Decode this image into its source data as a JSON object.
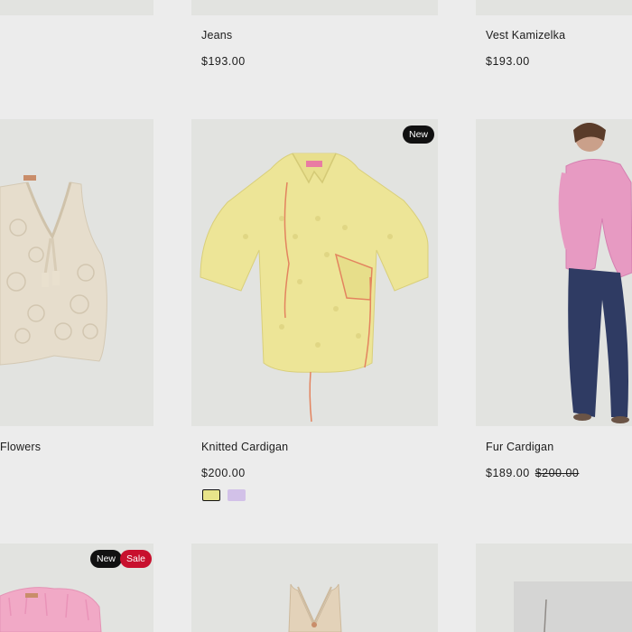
{
  "products": [
    {
      "name": "Jeans",
      "price": "$193.00"
    },
    {
      "name": "Vest Kamizelka",
      "price": "$193.00"
    },
    {
      "name": "Flowers"
    },
    {
      "name": "Knitted Cardigan",
      "price": "$200.00",
      "badge": "New",
      "swatches": [
        {
          "color": "#e8e48a",
          "selected": true
        },
        {
          "color": "#d2c1e8",
          "selected": false
        }
      ]
    },
    {
      "name": "Fur Cardigan",
      "price": "$189.00",
      "compare_price": "$200.00"
    },
    {
      "badges": [
        "New",
        "Sale"
      ]
    }
  ],
  "colors": {
    "background": "#ececec",
    "image_bg": "#e2e3e0",
    "badge_new": "#111111",
    "badge_sale": "#c8102e"
  }
}
